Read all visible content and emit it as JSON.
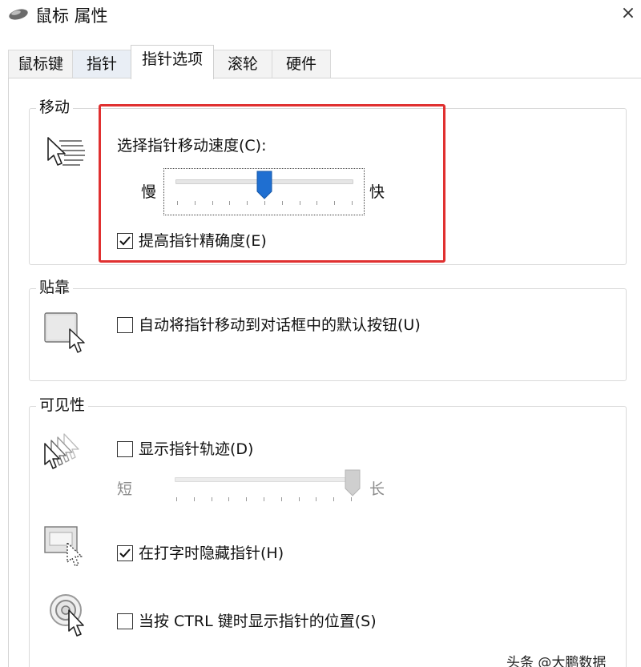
{
  "window": {
    "title": "鼠标 属性",
    "close_glyph": "×"
  },
  "tabs": [
    {
      "label": "鼠标键"
    },
    {
      "label": "指针"
    },
    {
      "label": "指针选项",
      "active": true
    },
    {
      "label": "滚轮"
    },
    {
      "label": "硬件"
    }
  ],
  "motion": {
    "group_title": "移动",
    "speed_label": "选择指针移动速度(C):",
    "slow_label": "慢",
    "fast_label": "快",
    "speed_level": 0.5,
    "enhance_precision_label": "提高指针精确度(E)",
    "enhance_precision_checked": true
  },
  "snap_to": {
    "group_title": "贴靠",
    "auto_snap_label": "自动将指针移动到对话框中的默认按钮(U)",
    "auto_snap_checked": false
  },
  "visibility": {
    "group_title": "可见性",
    "trails_label": "显示指针轨迹(D)",
    "trails_checked": false,
    "short_label": "短",
    "long_label": "长",
    "trail_length_level": 1.0,
    "hide_typing_label": "在打字时隐藏指针(H)",
    "hide_typing_checked": true,
    "ctrl_locate_label": "当按 CTRL 键时显示指针的位置(S)",
    "ctrl_locate_checked": false
  },
  "watermark": "头条 @大鹏数据",
  "colors": {
    "highlight": "#e03030",
    "slider_thumb": "#1f6fd1",
    "check": "#111111"
  },
  "icons": {
    "app": "mouse-icon",
    "speed": "pointer-speed-icon",
    "snap": "snap-to-icon",
    "trails": "pointer-trails-icon",
    "hide": "hide-pointer-icon",
    "locate": "locate-pointer-icon"
  }
}
